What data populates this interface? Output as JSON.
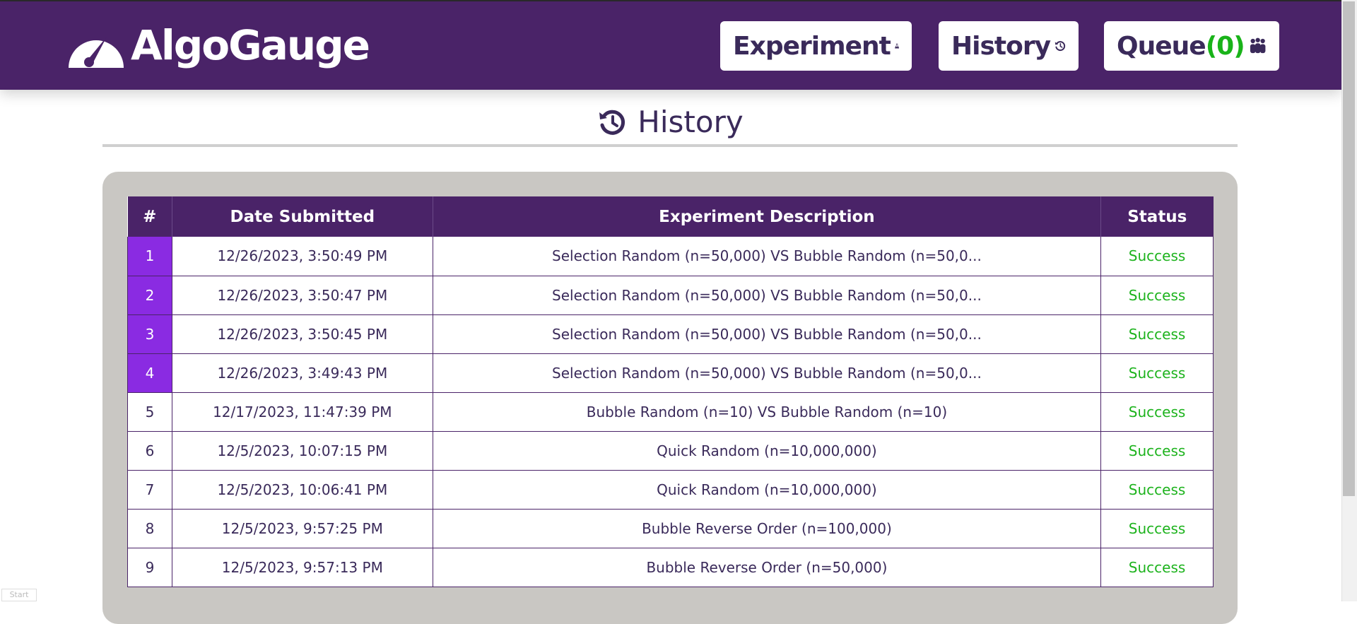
{
  "app": {
    "name": "AlgoGauge"
  },
  "nav": {
    "experiment_label": "Experiment",
    "history_label": "History",
    "queue_label": "Queue",
    "queue_count": "(0)"
  },
  "page": {
    "title": "History"
  },
  "table": {
    "headers": [
      "#",
      "Date Submitted",
      "Experiment Description",
      "Status"
    ],
    "rows": [
      {
        "num": "1",
        "date": "12/26/2023, 3:50:49 PM",
        "desc": "Selection Random (n=50,000) VS Bubble Random (n=50,0...",
        "status": "Success"
      },
      {
        "num": "2",
        "date": "12/26/2023, 3:50:47 PM",
        "desc": "Selection Random (n=50,000) VS Bubble Random (n=50,0...",
        "status": "Success"
      },
      {
        "num": "3",
        "date": "12/26/2023, 3:50:45 PM",
        "desc": "Selection Random (n=50,000) VS Bubble Random (n=50,0...",
        "status": "Success"
      },
      {
        "num": "4",
        "date": "12/26/2023, 3:49:43 PM",
        "desc": "Selection Random (n=50,000) VS Bubble Random (n=50,0...",
        "status": "Success"
      },
      {
        "num": "5",
        "date": "12/17/2023, 11:47:39 PM",
        "desc": "Bubble Random (n=10) VS Bubble Random (n=10)",
        "status": "Success"
      },
      {
        "num": "6",
        "date": "12/5/2023, 10:07:15 PM",
        "desc": "Quick Random (n=10,000,000)",
        "status": "Success"
      },
      {
        "num": "7",
        "date": "12/5/2023, 10:06:41 PM",
        "desc": "Quick Random (n=10,000,000)",
        "status": "Success"
      },
      {
        "num": "8",
        "date": "12/5/2023, 9:57:25 PM",
        "desc": "Bubble Reverse Order (n=100,000)",
        "status": "Success"
      },
      {
        "num": "9",
        "date": "12/5/2023, 9:57:13 PM",
        "desc": "Bubble Reverse Order (n=50,000)",
        "status": "Success"
      }
    ]
  },
  "footer": {
    "start_label": "Start"
  },
  "colors": {
    "brand": "#4a2368",
    "highlight": "#8a2be2",
    "success": "#1db31d"
  },
  "icons": {
    "logo": "gauge-icon",
    "experiment": "flask-icon",
    "history": "history-icon",
    "queue": "users-icon"
  }
}
